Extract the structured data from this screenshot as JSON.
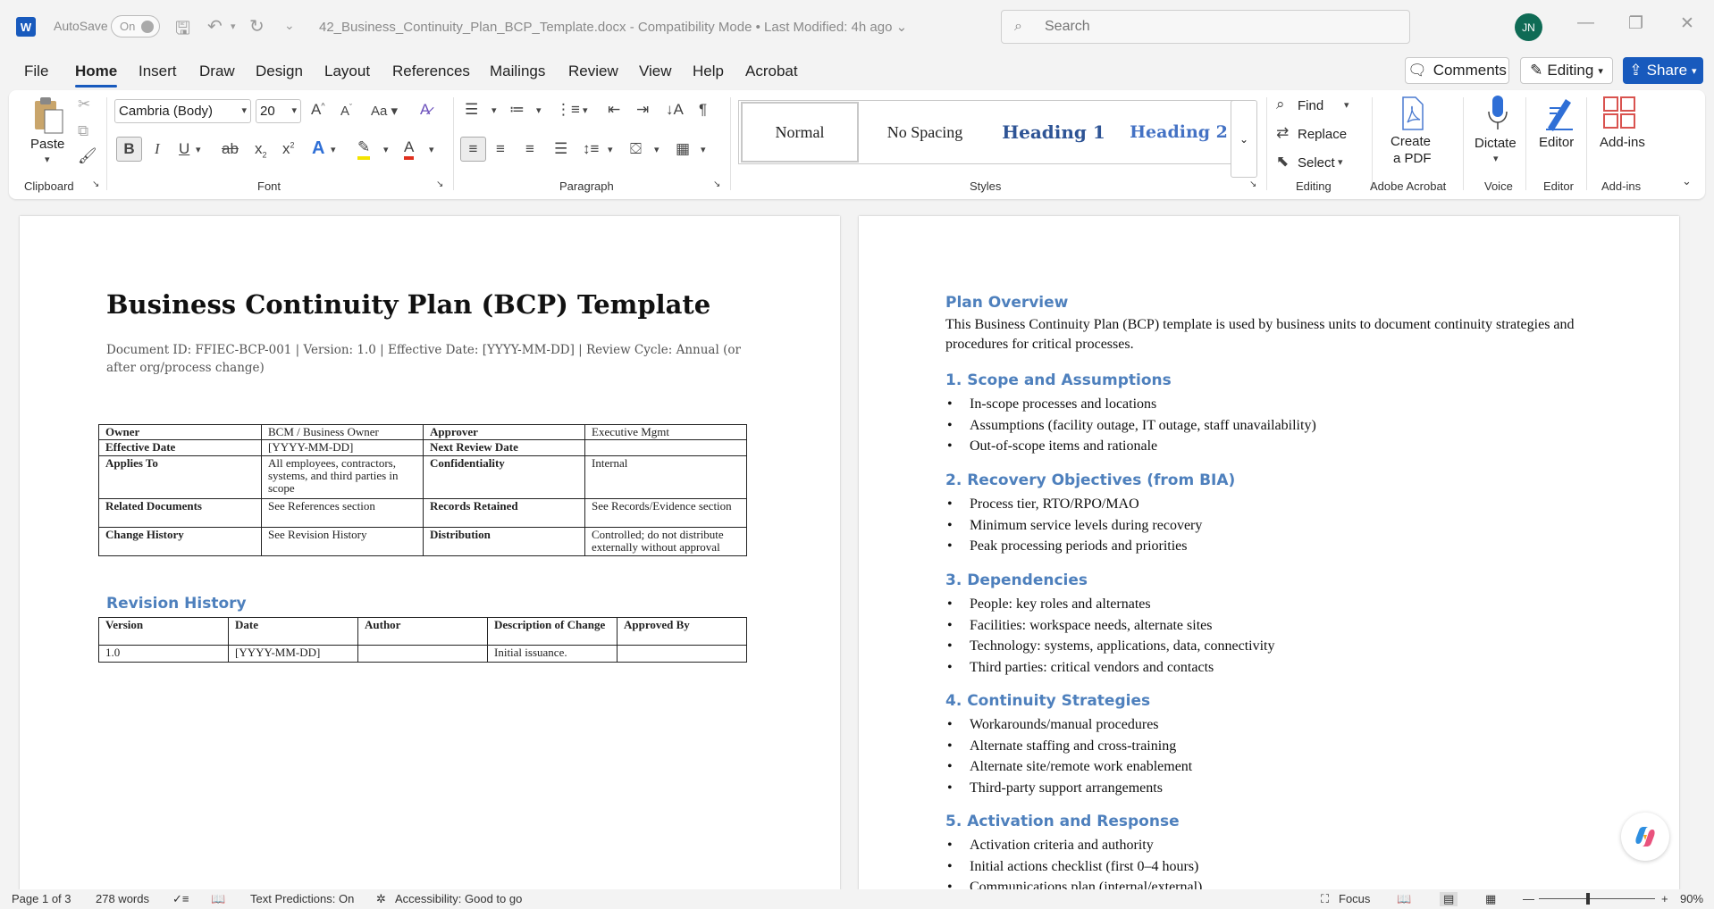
{
  "titlebar": {
    "app_icon": "W",
    "autosave_label": "AutoSave",
    "autosave_state": "On",
    "doc_title": "42_Business_Continuity_Plan_BCP_Template.docx  -  Compatibility Mode  •  Last Modified: 4h ago",
    "search_placeholder": "Search",
    "avatar_initials": "JN"
  },
  "menu": {
    "items": [
      "File",
      "Home",
      "Insert",
      "Draw",
      "Design",
      "Layout",
      "References",
      "Mailings",
      "Review",
      "View",
      "Help",
      "Acrobat"
    ],
    "active": "Home",
    "comments_label": "Comments",
    "editing_label": "Editing",
    "share_label": "Share"
  },
  "ribbon": {
    "paste_label": "Paste",
    "font_name": "Cambria (Body)",
    "font_size": "20",
    "styles": [
      "Normal",
      "No Spacing",
      "Heading 1",
      "Heading 2"
    ],
    "find_label": "Find",
    "replace_label": "Replace",
    "select_label": "Select",
    "create_pdf_label_1": "Create",
    "create_pdf_label_2": "a PDF",
    "dictate_label": "Dictate",
    "editor_label": "Editor",
    "addins_label": "Add-ins",
    "groups": {
      "clipboard": "Clipboard",
      "font": "Font",
      "paragraph": "Paragraph",
      "styles": "Styles",
      "editing": "Editing",
      "adobe": "Adobe Acrobat",
      "voice": "Voice",
      "editor": "Editor",
      "addins": "Add-ins"
    }
  },
  "page1": {
    "title": "Business Continuity Plan (BCP) Template",
    "meta_line": "Document ID: FFIEC-BCP-001 | Version: 1.0 | Effective Date: [YYYY-MM-DD] | Review Cycle: Annual (or after org/process change)",
    "meta_table": [
      [
        "Owner",
        "BCM / Business Owner",
        "Approver",
        "Executive Mgmt"
      ],
      [
        "Effective Date",
        "[YYYY-MM-DD]",
        "Next Review Date",
        ""
      ],
      [
        "Applies To",
        "All employees, contractors, systems, and third parties in scope",
        "Confidentiality",
        "Internal"
      ],
      [
        "Related Documents",
        "See References section",
        "Records Retained",
        "See Records/Evidence section"
      ],
      [
        "Change History",
        "See Revision History",
        "Distribution",
        "Controlled; do not distribute externally without approval"
      ]
    ],
    "revision_title": "Revision History",
    "revision_headers": [
      "Version",
      "Date",
      "Author",
      "Description of Change",
      "Approved By"
    ],
    "revision_row": [
      "1.0",
      "[YYYY-MM-DD]",
      "",
      "Initial issuance.",
      ""
    ]
  },
  "page2": {
    "overview_title": "Plan Overview",
    "overview_text": "This Business Continuity Plan (BCP) template is used by business units to document continuity strategies and procedures for critical processes.",
    "sections": [
      {
        "title": "1. Scope and Assumptions",
        "items": [
          "In-scope processes and locations",
          "Assumptions (facility outage, IT outage, staff unavailability)",
          "Out-of-scope items and rationale"
        ]
      },
      {
        "title": "2. Recovery Objectives (from BIA)",
        "items": [
          "Process tier, RTO/RPO/MAO",
          "Minimum service levels during recovery",
          "Peak processing periods and priorities"
        ]
      },
      {
        "title": "3. Dependencies",
        "items": [
          "People: key roles and alternates",
          "Facilities: workspace needs, alternate sites",
          "Technology: systems, applications, data, connectivity",
          "Third parties: critical vendors and contacts"
        ]
      },
      {
        "title": "4. Continuity Strategies",
        "items": [
          "Workarounds/manual procedures",
          "Alternate staffing and cross-training",
          "Alternate site/remote work enablement",
          "Third-party support arrangements"
        ]
      },
      {
        "title": "5. Activation and Response",
        "items": [
          "Activation criteria and authority",
          "Initial actions checklist (first 0–4 hours)",
          "Communications plan (internal/external)"
        ]
      }
    ]
  },
  "status": {
    "page": "Page 1 of 3",
    "words": "278 words",
    "text_predictions": "Text Predictions: On",
    "accessibility": "Accessibility: Good to go",
    "focus": "Focus",
    "zoom": "90%"
  }
}
